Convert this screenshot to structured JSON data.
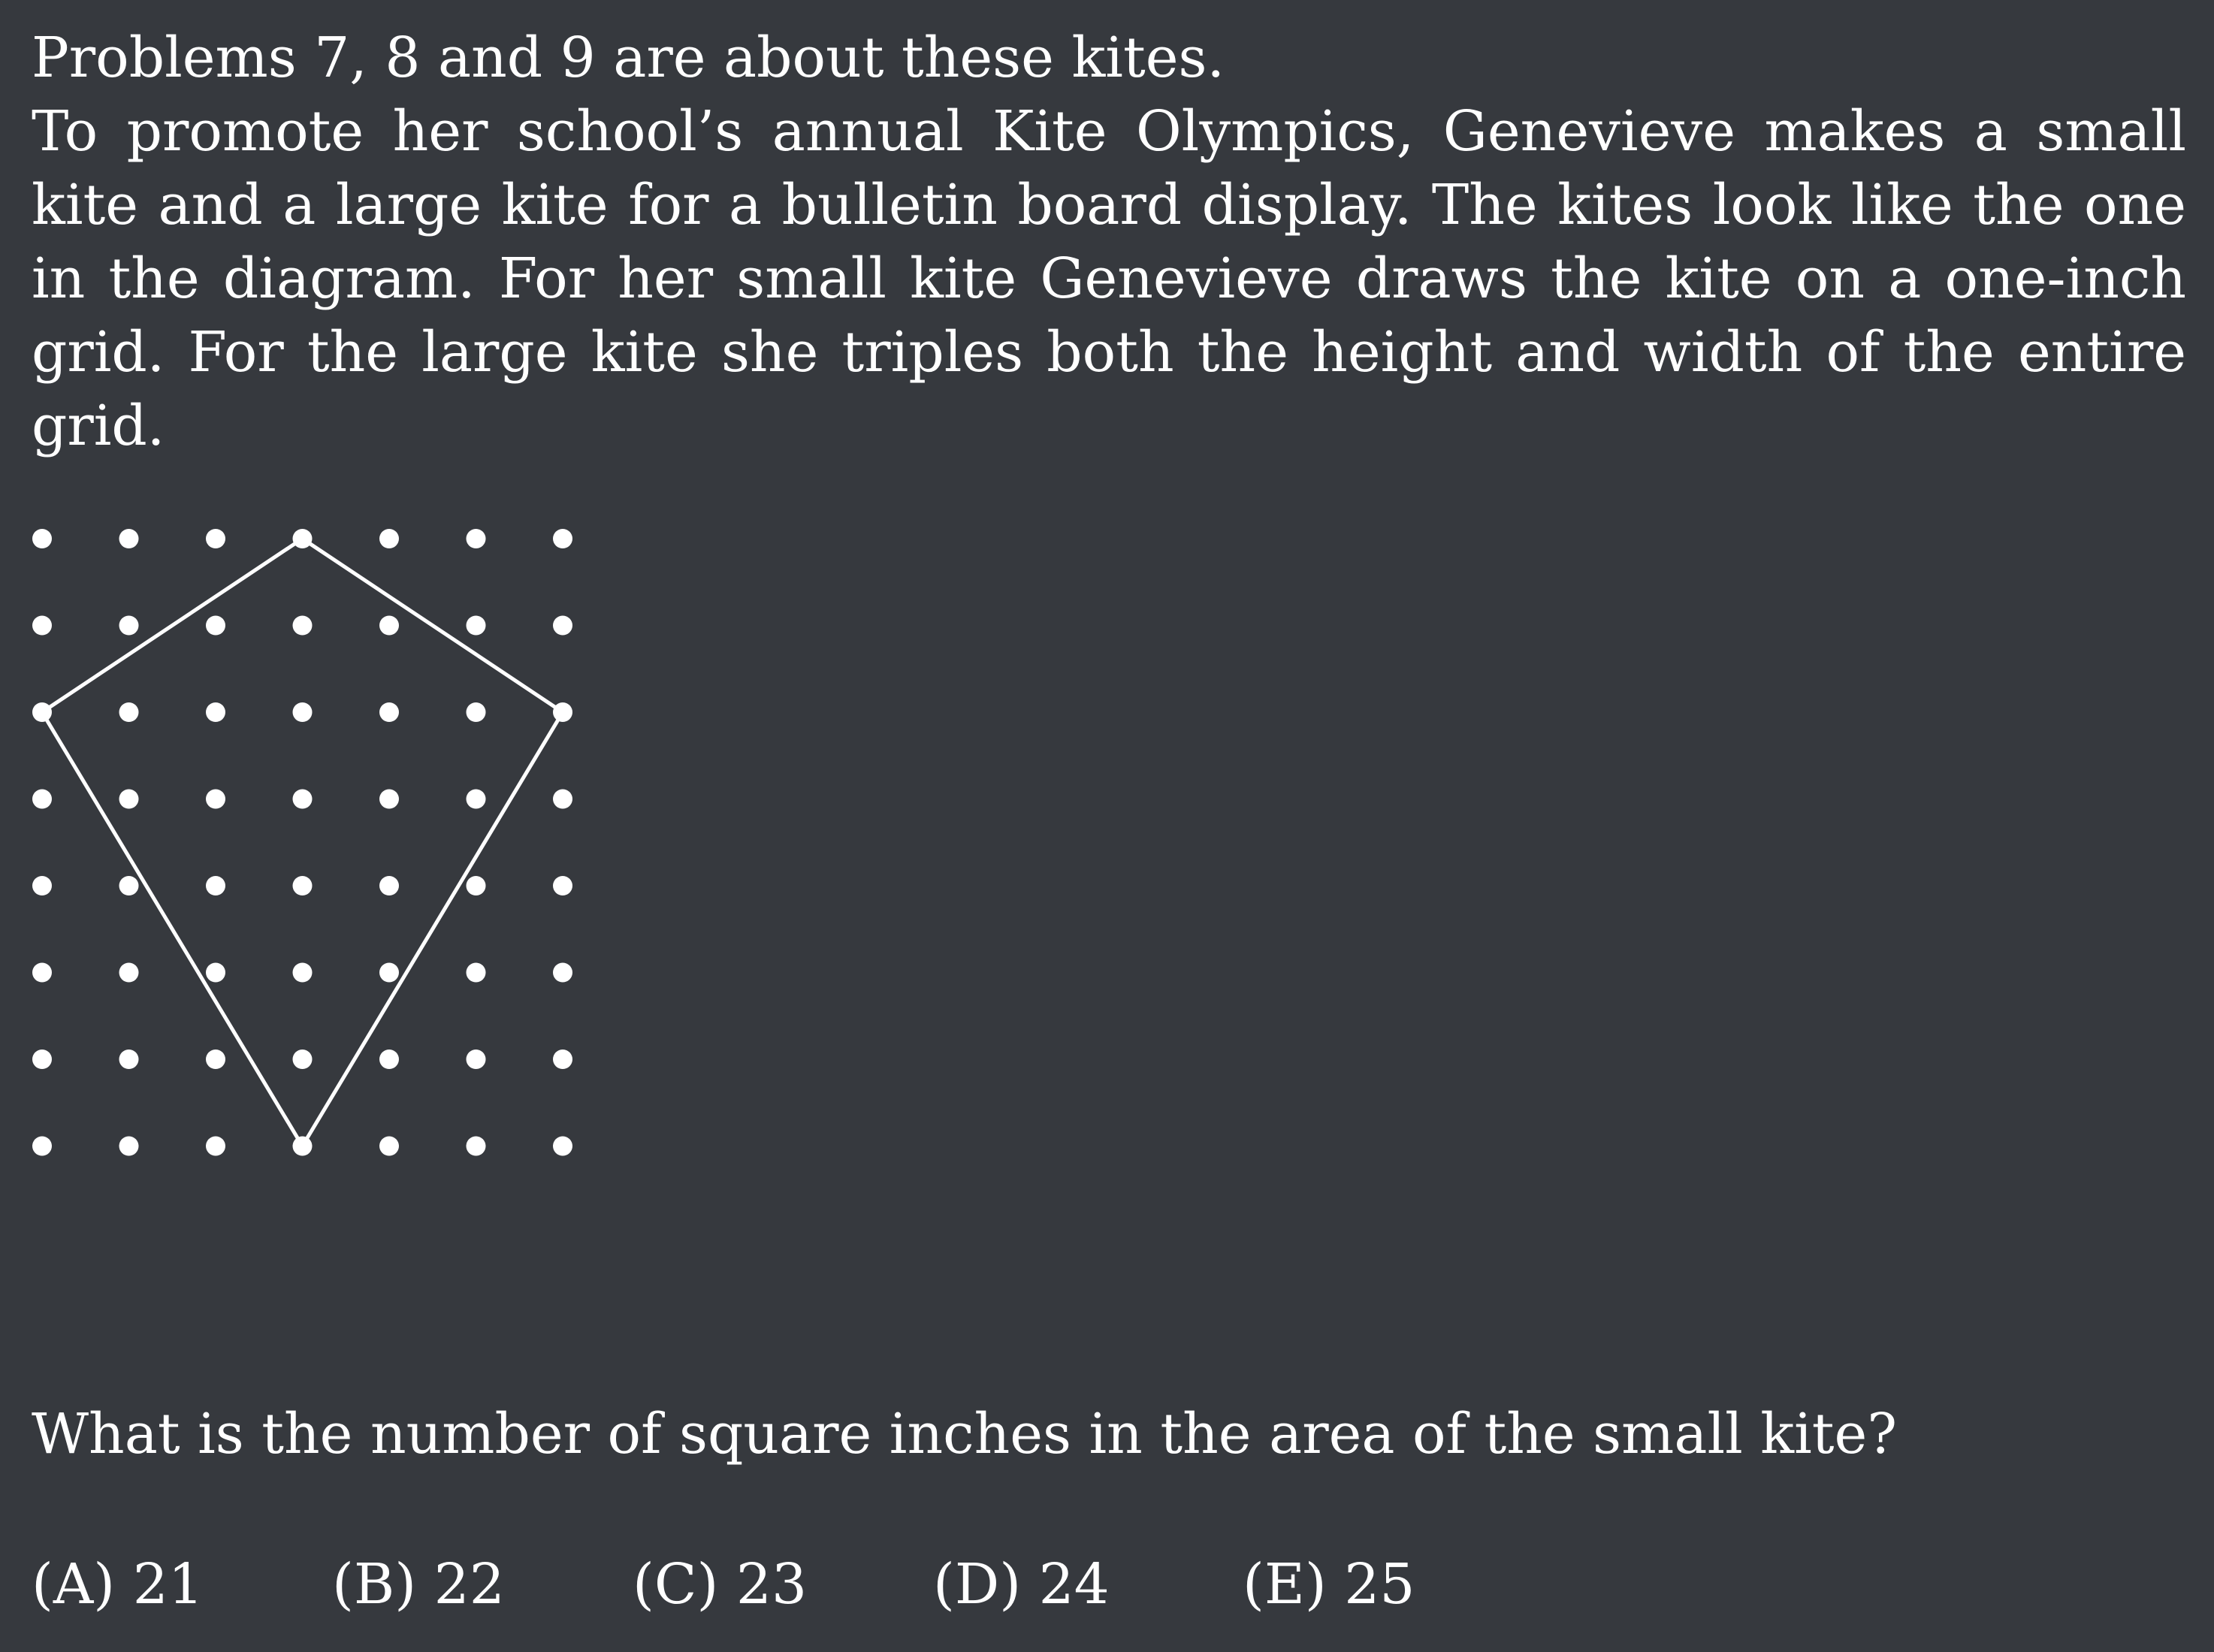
{
  "intro": {
    "line1": "Problems 7, 8 and 9 are about these kites.",
    "paragraph": "To promote her school’s annual Kite Olympics, Genevieve makes a small kite and a large kite for a bulletin board display. The kites look like the one in the diagram. For her small kite Genevieve draws the kite on a one-inch grid. For the large kite she triples both the height and width of the entire grid."
  },
  "diagram": {
    "grid": {
      "columns": 7,
      "rows": 8
    },
    "kite_vertices": [
      [
        3,
        0
      ],
      [
        6,
        2
      ],
      [
        3,
        7
      ],
      [
        0,
        2
      ]
    ],
    "dot_color": "#ffffff",
    "line_color": "#ffffff"
  },
  "question": {
    "text": "What is the number of square inches in the area of the small kite?"
  },
  "choices": [
    {
      "label": "(A) 21"
    },
    {
      "label": "(B) 22"
    },
    {
      "label": "(C) 23"
    },
    {
      "label": "(D) 24"
    },
    {
      "label": "(E) 25"
    }
  ]
}
